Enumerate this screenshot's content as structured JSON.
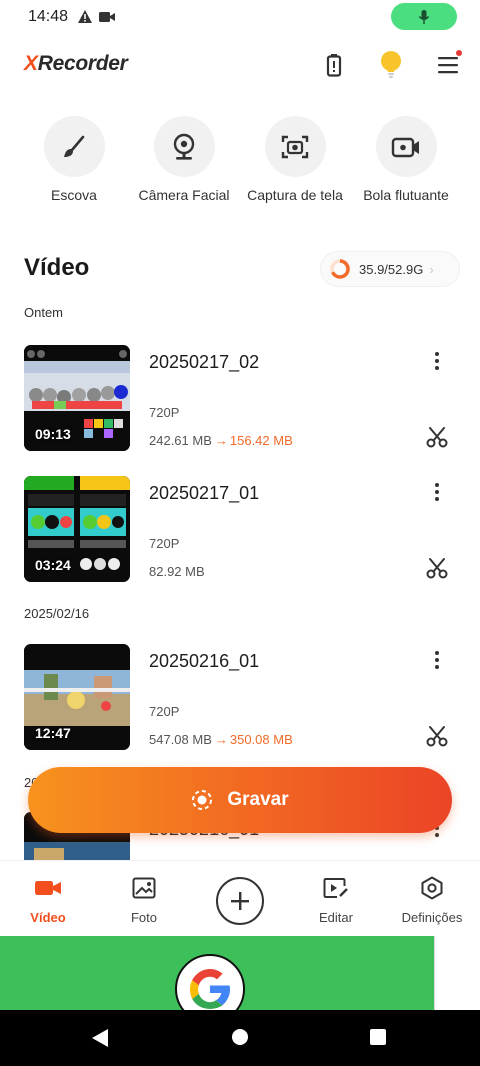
{
  "status": {
    "time": "14:48"
  },
  "app": {
    "logo_x": "X",
    "logo_rest": "Recorder"
  },
  "tools": [
    {
      "label": "Escova",
      "icon": "brush-icon"
    },
    {
      "label": "Câmera Facial",
      "icon": "webcam-icon"
    },
    {
      "label": "Captura de tela",
      "icon": "screenshot-icon"
    },
    {
      "label": "Bola flutuante",
      "icon": "floating-ball-icon"
    }
  ],
  "section": {
    "title": "Vídeo",
    "storage": "35.9/52.9G",
    "storage_used_fraction": 0.68
  },
  "groups": [
    {
      "date": "Ontem"
    },
    {
      "date": "2025/02/16"
    },
    {
      "date": "20"
    }
  ],
  "videos": [
    {
      "name": "20250217_02",
      "resolution": "720P",
      "size": "242.61 MB",
      "compressed": "156.42 MB",
      "duration": "09:13"
    },
    {
      "name": "20250217_01",
      "resolution": "720P",
      "size": "82.92 MB",
      "compressed": "",
      "duration": "03:24"
    },
    {
      "name": "20250216_01",
      "resolution": "720P",
      "size": "547.08 MB",
      "compressed": "350.08 MB",
      "duration": "12:47"
    },
    {
      "name": "20250216_01",
      "resolution": "",
      "size": "",
      "compressed": "",
      "duration": ""
    }
  ],
  "record": {
    "label": "Gravar"
  },
  "nav": {
    "video": "Vídeo",
    "photo": "Foto",
    "edit": "Editar",
    "settings": "Definições"
  },
  "colors": {
    "accent": "#f24e1e",
    "record_start": "#f7931e",
    "record_end": "#eb4426",
    "ad_green": "#3dbf5a"
  }
}
